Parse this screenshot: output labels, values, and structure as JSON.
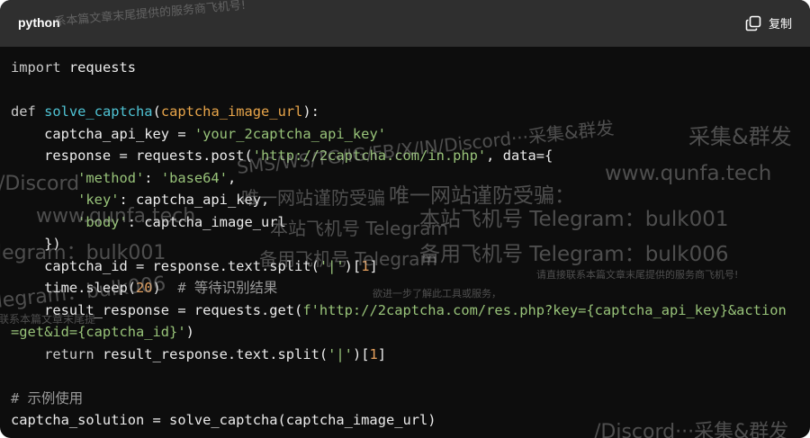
{
  "header": {
    "language": "python",
    "copy_label": "复制"
  },
  "code": {
    "l1_import": "import",
    "l1_module": " requests",
    "l3_def": "def",
    "l3_fn": "solve_captcha",
    "l3_paren_open": "(",
    "l3_param": "captcha_image_url",
    "l3_paren_close": "):",
    "l4_a": "    captcha_api_key = ",
    "l4_str": "'your_2captcha_api_key'",
    "l5_a": "    response = requests.post(",
    "l5_str": "'http://2captcha.com/in.php'",
    "l5_b": ", data={",
    "l6_indent": "        ",
    "l6_key": "'method'",
    "l6_sep": ": ",
    "l6_val": "'base64'",
    "l6_end": ",",
    "l7_indent": "        ",
    "l7_key": "'key'",
    "l7_rest": ": captcha_api_key,",
    "l8_indent": "        ",
    "l8_key": "'body'",
    "l8_rest": ": captcha_image_url",
    "l9": "    })",
    "l10_a": "    captcha_id = response.text.split(",
    "l10_str": "'|'",
    "l10_b": ")[",
    "l10_num": "1",
    "l10_c": "]",
    "l11_a": "    time.sleep(",
    "l11_num": "20",
    "l11_b": ")  ",
    "l11_com": "# 等待识别结果",
    "l12_a": "    result_response = requests.get(",
    "l12_str": "f'http://2captcha.com/res.php?key={captcha_api_key}&action",
    "l13_str": "=get&id={captcha_id}'",
    "l13_b": ")",
    "l14_ret": "    return",
    "l14_a": " result_response.text.split(",
    "l14_str": "'|'",
    "l14_b": ")[",
    "l14_num": "1",
    "l14_c": "]",
    "l16_com": "# 示例使用",
    "l17": "captcha_solution = solve_captcha(captcha_image_url)"
  },
  "watermarks": {
    "w1": "系本篇文章末尾提供的服务商飞机号!",
    "w2": "采集&群发",
    "w3": "www.qunfa.tech",
    "w4": "唯一网站谨防受骗：",
    "w5": "本站飞机号 Telegram：bulk001",
    "w6": "备用飞机号 Telegram：bulk006",
    "w7": "请直接联系本篇文章末尾提供的服务商飞机号!",
    "w8": "欲进一步了解此工具或服务，",
    "w9": "/Discord",
    "w10": "www.qunfa.tech",
    "w11": "legram：bulk001",
    "w12": "legram：bulk006",
    "w13": "联系本篇文章末尾提",
    "w14": "/Discord···采集&群发",
    "w15": "SMS/WS/TG/IG/FB/X/IN/Discord···采集&群发",
    "w16": "唯一网站谨防受骗",
    "w17": "本站飞机号 Telegram",
    "w18": "备用飞机号 Telegram"
  }
}
